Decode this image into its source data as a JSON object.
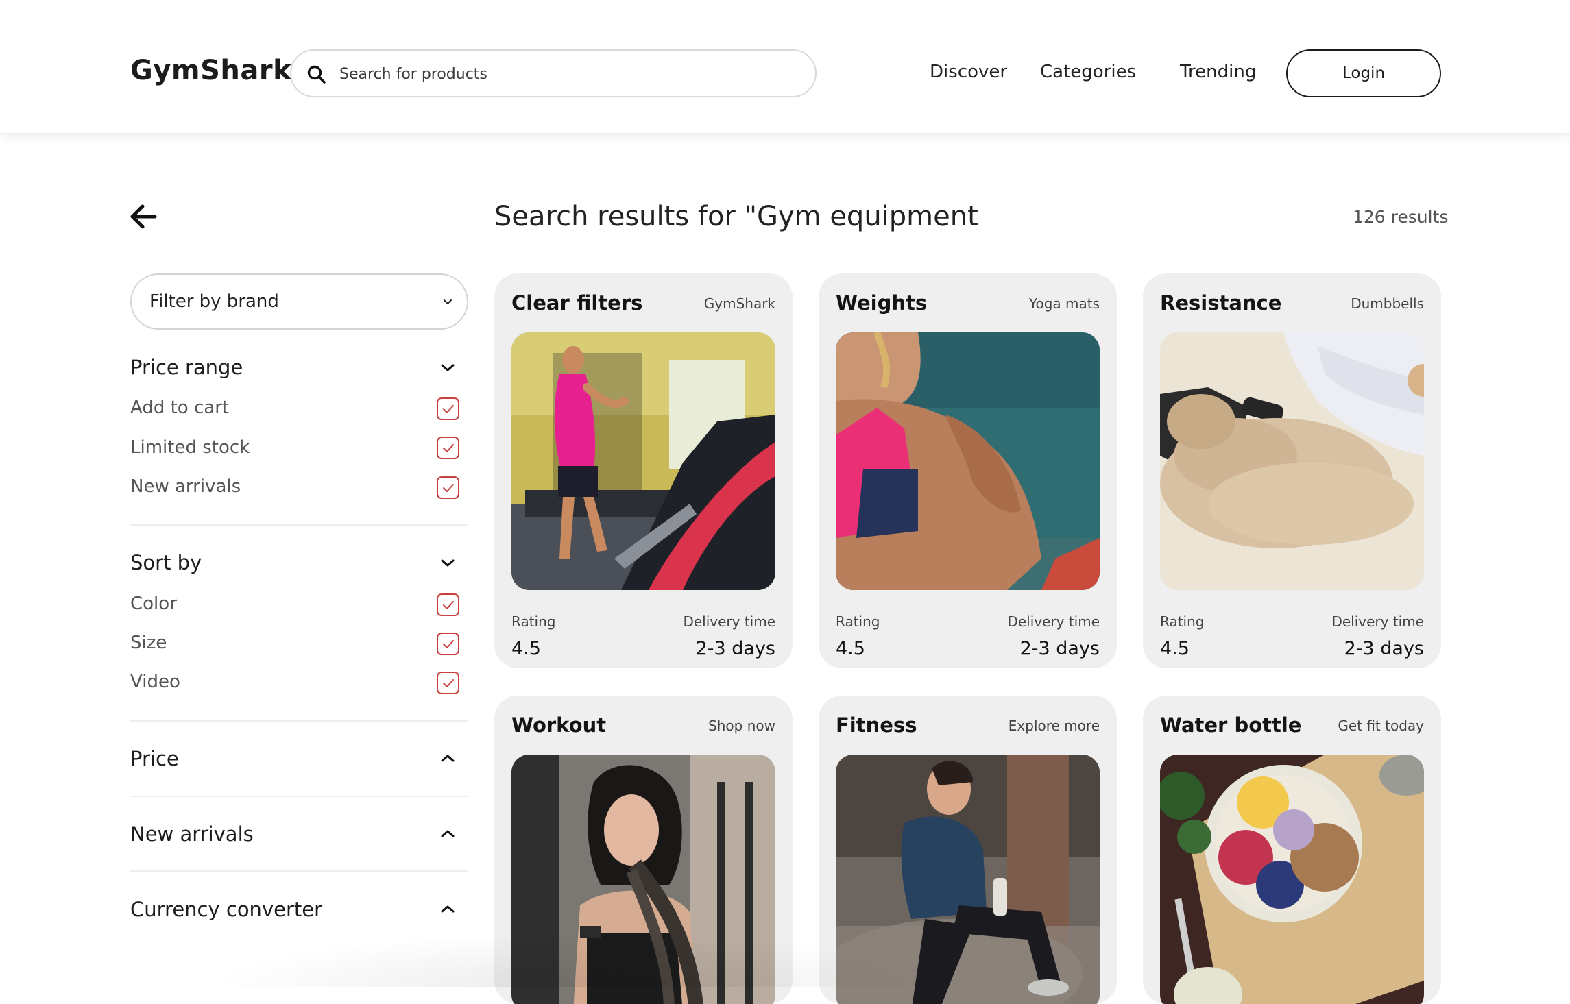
{
  "header": {
    "brand": "GymShark",
    "search_placeholder": "Search for products",
    "nav": [
      "Discover",
      "Categories",
      "Trending"
    ],
    "login_label": "Login"
  },
  "sidebar": {
    "brand_filter_label": "Filter by brand",
    "sections": [
      {
        "title": "Price range",
        "expanded": true,
        "options": [
          "Add to cart",
          "Limited stock",
          "New arrivals"
        ]
      },
      {
        "title": "Sort by",
        "expanded": true,
        "options": [
          "Color",
          "Size",
          "Video"
        ]
      },
      {
        "title": "Price",
        "expanded": false
      },
      {
        "title": "New arrivals",
        "expanded": false
      },
      {
        "title": "Currency converter",
        "expanded": false
      }
    ]
  },
  "main": {
    "title": "Search results for \"Gym equipment",
    "count": "126 results",
    "cards": [
      {
        "title": "Clear filters",
        "subtitle": "GymShark",
        "rating_label": "Rating",
        "rating": "4.5",
        "delivery_label": "Delivery time",
        "delivery": "2-3 days",
        "image": "treadmill-runner"
      },
      {
        "title": "Weights",
        "subtitle": "Yoga mats",
        "rating_label": "Rating",
        "rating": "4.5",
        "delivery_label": "Delivery time",
        "delivery": "2-3 days",
        "image": "athlete-shoulder"
      },
      {
        "title": "Resistance",
        "subtitle": "Dumbbells",
        "rating_label": "Rating",
        "rating": "4.5",
        "delivery_label": "Delivery time",
        "delivery": "2-3 days",
        "image": "protein-powder"
      },
      {
        "title": "Workout",
        "subtitle": "Shop now",
        "image": "battle-ropes-woman"
      },
      {
        "title": "Fitness",
        "subtitle": "Explore more",
        "image": "runner-resting"
      },
      {
        "title": "Water bottle",
        "subtitle": "Get fit today",
        "image": "smoothie-bowl"
      }
    ]
  },
  "colors": {
    "checkbox": "#c94040",
    "card_bg": "#efefef",
    "text": "#1a1a1a"
  }
}
